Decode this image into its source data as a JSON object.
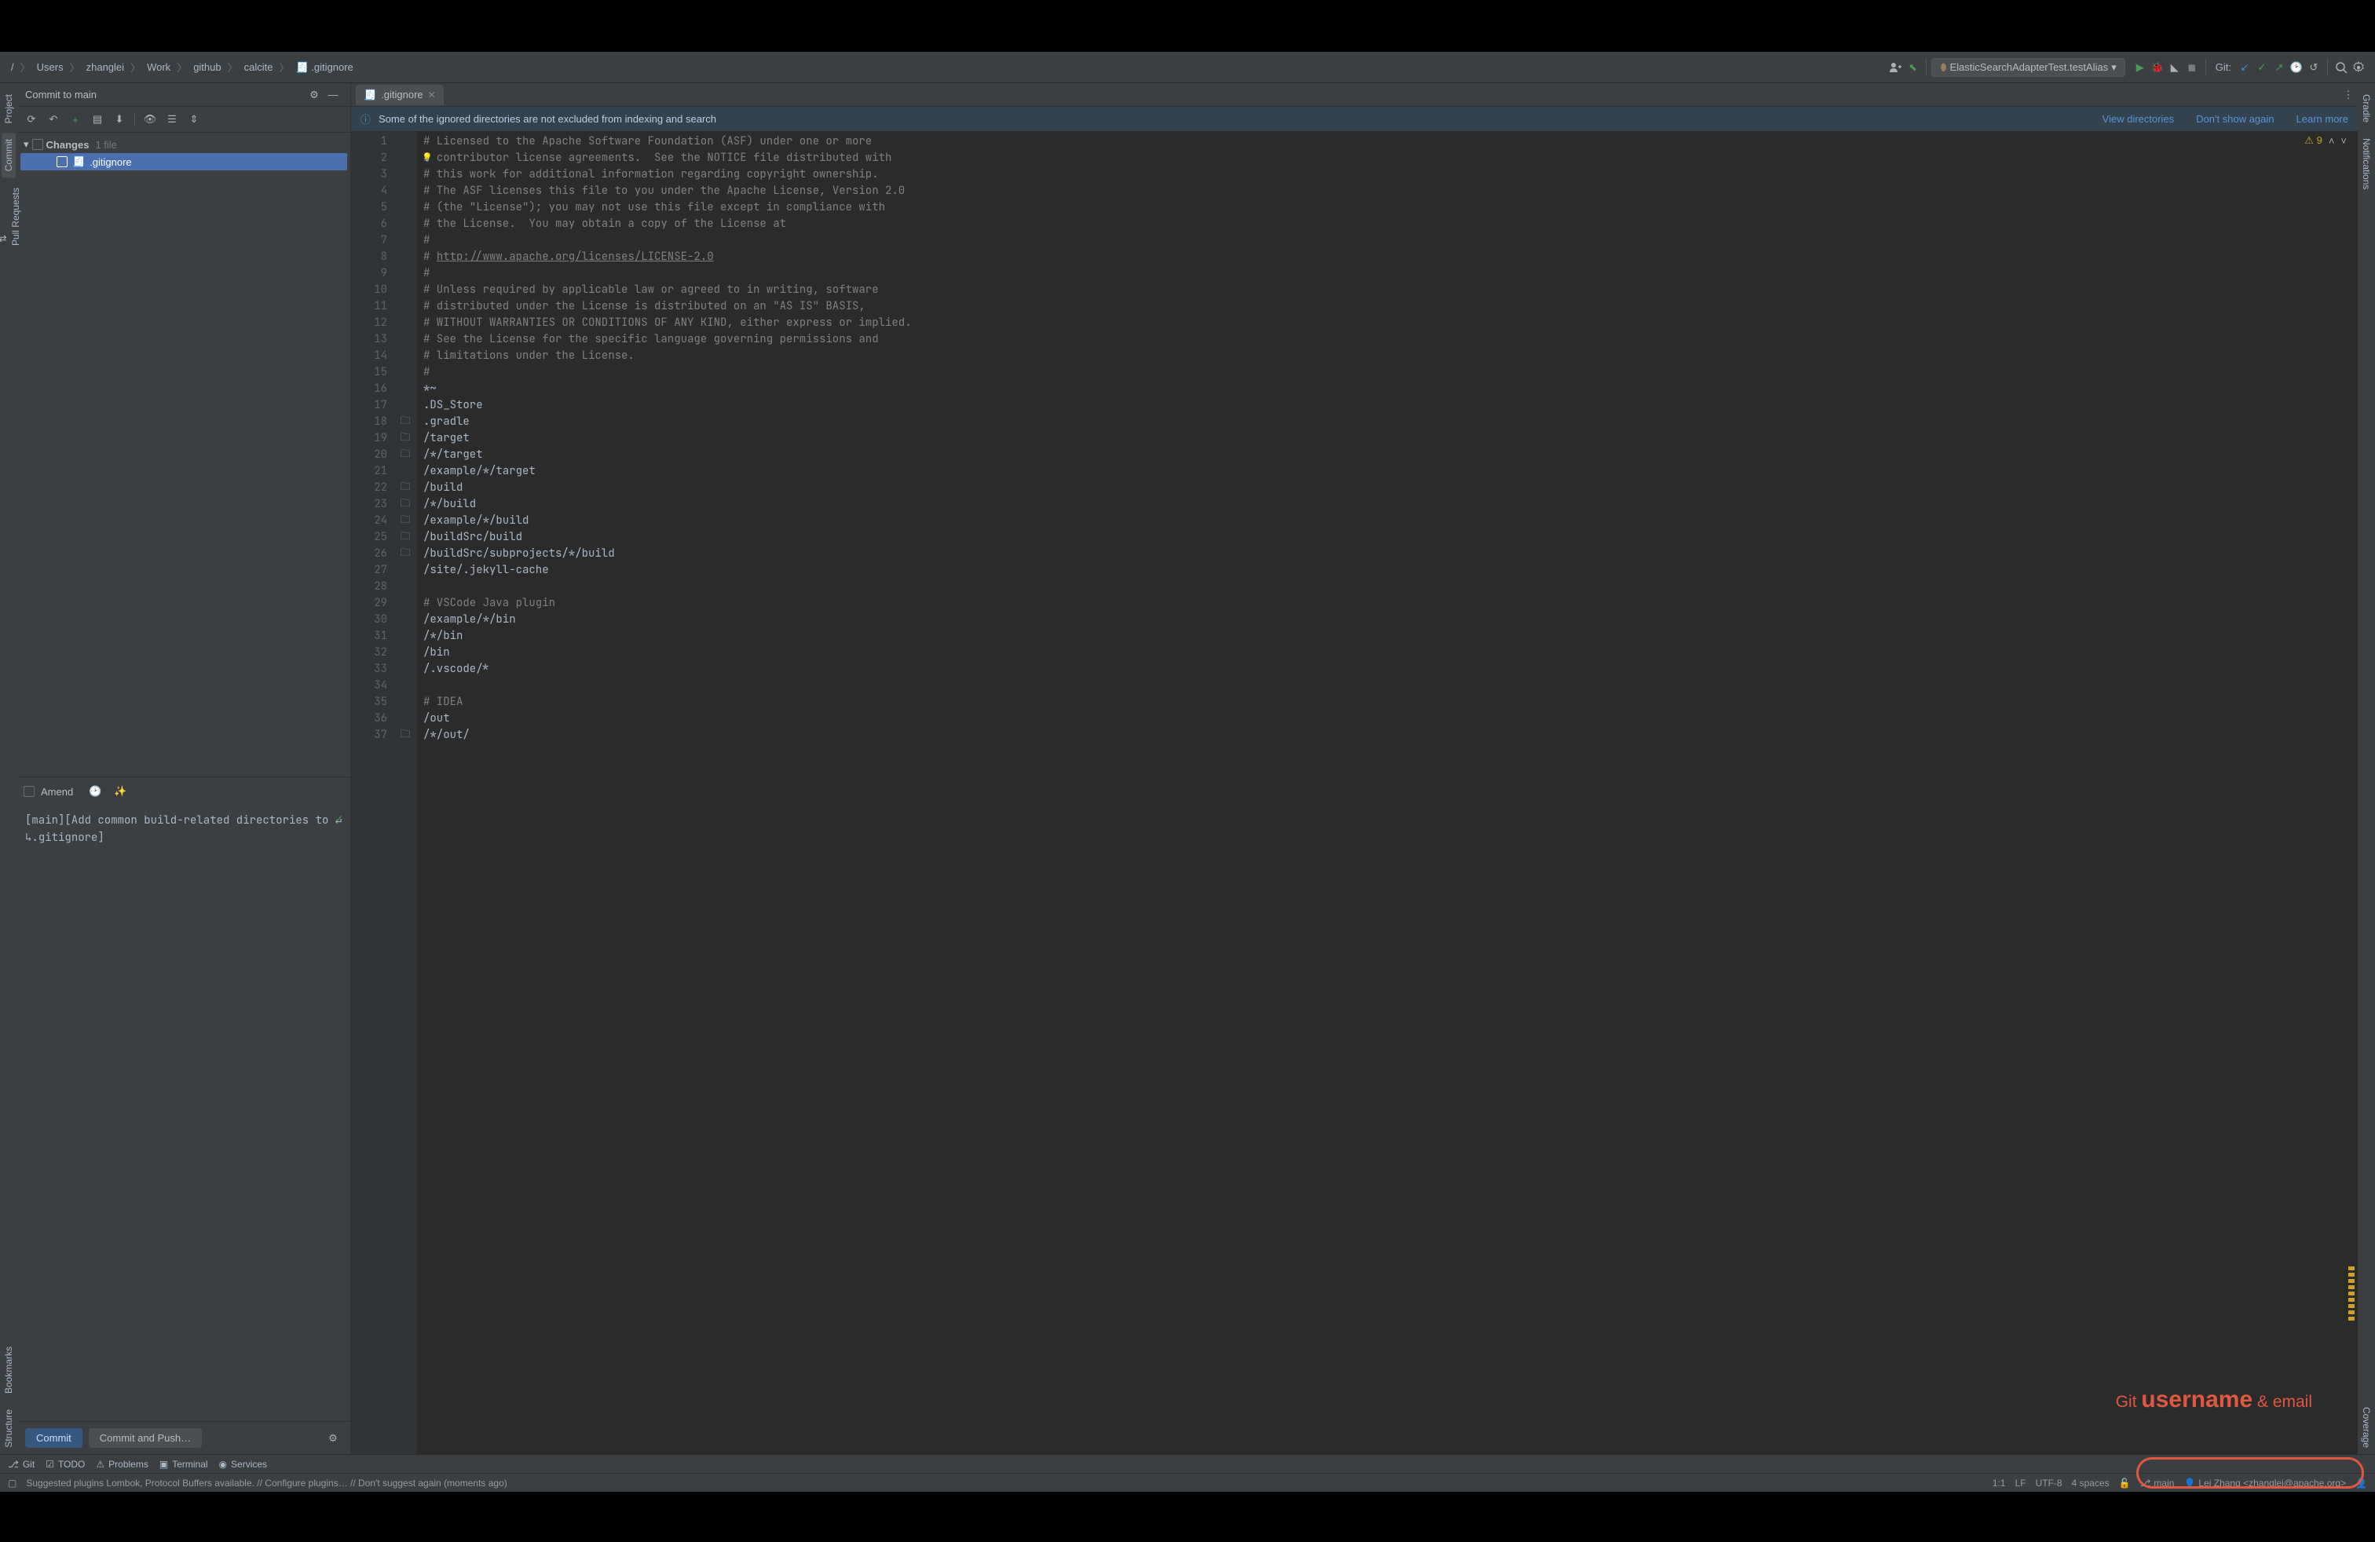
{
  "breadcrumb": [
    "Users",
    "zhanglei",
    "Work",
    "github",
    "calcite",
    ".gitignore"
  ],
  "runConfig": {
    "icon": "elastic",
    "label": "ElasticSearchAdapterTest.testAlias"
  },
  "navGitLabel": "Git:",
  "commitPanel": {
    "title": "Commit to main",
    "changesLabel": "Changes",
    "changesCount": "1 file",
    "fileName": ".gitignore",
    "amendLabel": "Amend",
    "commitMessage": "[main][Add common build-related directories to ↵\n↳.gitignore]",
    "commitBtn": "Commit",
    "commitPushBtn": "Commit and Push…"
  },
  "editor": {
    "tabName": ".gitignore",
    "banner": {
      "text": "Some of the ignored directories are not excluded from indexing and search",
      "viewDirs": "View directories",
      "dontShow": "Don't show again",
      "learnMore": "Learn more"
    },
    "warningCount": "9",
    "lines": [
      {
        "n": 1,
        "t": "# Licensed to the Apache Software Foundation (ASF) under one or more",
        "c": true
      },
      {
        "n": 2,
        "t": "# contributor license agreements.  See the NOTICE file distributed with",
        "c": true,
        "bulb": true
      },
      {
        "n": 3,
        "t": "# this work for additional information regarding copyright ownership.",
        "c": true
      },
      {
        "n": 4,
        "t": "# The ASF licenses this file to you under the Apache License, Version 2.0",
        "c": true
      },
      {
        "n": 5,
        "t": "# (the \"License\"); you may not use this file except in compliance with",
        "c": true
      },
      {
        "n": 6,
        "t": "# the License.  You may obtain a copy of the License at",
        "c": true
      },
      {
        "n": 7,
        "t": "#",
        "c": true
      },
      {
        "n": 8,
        "t": "# ",
        "c": true,
        "url": "http://www.apache.org/licenses/LICENSE-2.0"
      },
      {
        "n": 9,
        "t": "#",
        "c": true
      },
      {
        "n": 10,
        "t": "# Unless required by applicable law or agreed to in writing, software",
        "c": true
      },
      {
        "n": 11,
        "t": "# distributed under the License is distributed on an \"AS IS\" BASIS,",
        "c": true
      },
      {
        "n": 12,
        "t": "# WITHOUT WARRANTIES OR CONDITIONS OF ANY KIND, either express or implied.",
        "c": true
      },
      {
        "n": 13,
        "t": "# See the License for the specific language governing permissions and",
        "c": true
      },
      {
        "n": 14,
        "t": "# limitations under the License.",
        "c": true
      },
      {
        "n": 15,
        "t": "#",
        "c": true
      },
      {
        "n": 16,
        "t": "*~"
      },
      {
        "n": 17,
        "t": ".DS_Store"
      },
      {
        "n": 18,
        "t": ".gradle",
        "folder": true
      },
      {
        "n": 19,
        "t": "/target",
        "folder": true
      },
      {
        "n": 20,
        "t": "/*/target",
        "folder": true
      },
      {
        "n": 21,
        "t": "/example/*/target"
      },
      {
        "n": 22,
        "t": "/build",
        "folder": true
      },
      {
        "n": 23,
        "t": "/*/build",
        "folder": true
      },
      {
        "n": 24,
        "t": "/example/*/build",
        "folder": true
      },
      {
        "n": 25,
        "t": "/buildSrc/build",
        "folder": true
      },
      {
        "n": 26,
        "t": "/buildSrc/subprojects/*/build",
        "folder": true
      },
      {
        "n": 27,
        "t": "/site/.jekyll-cache"
      },
      {
        "n": 28,
        "t": ""
      },
      {
        "n": 29,
        "t": "# VSCode Java plugin",
        "c": true
      },
      {
        "n": 30,
        "t": "/example/*/bin"
      },
      {
        "n": 31,
        "t": "/*/bin"
      },
      {
        "n": 32,
        "t": "/bin"
      },
      {
        "n": 33,
        "t": "/.vscode/*"
      },
      {
        "n": 34,
        "t": ""
      },
      {
        "n": 35,
        "t": "# IDEA",
        "c": true
      },
      {
        "n": 36,
        "t": "/out"
      },
      {
        "n": 37,
        "t": "/*/out/",
        "folder": true
      }
    ]
  },
  "leftTabs": [
    "Project",
    "Commit",
    "Pull Requests"
  ],
  "leftTabsBottom": [
    "Bookmarks",
    "Structure"
  ],
  "rightTabs": [
    "Gradle",
    "Notifications",
    "Coverage"
  ],
  "bottomTabs": [
    {
      "icon": "branch",
      "label": "Git"
    },
    {
      "icon": "todo",
      "label": "TODO"
    },
    {
      "icon": "warn",
      "label": "Problems"
    },
    {
      "icon": "terminal",
      "label": "Terminal"
    },
    {
      "icon": "services",
      "label": "Services"
    }
  ],
  "statusBar": {
    "suggestion": "Suggested plugins Lombok, Protocol Buffers available. // Configure plugins… // Don't suggest again (moments ago)",
    "pos": "1:1",
    "lineSep": "LF",
    "encoding": "UTF-8",
    "indent": "4 spaces",
    "branch": "main",
    "gitUser": "Lei Zhang <zhanglei@apache.org>"
  },
  "annotation": {
    "pre": "Git ",
    "big": "username",
    "post": " & email"
  }
}
